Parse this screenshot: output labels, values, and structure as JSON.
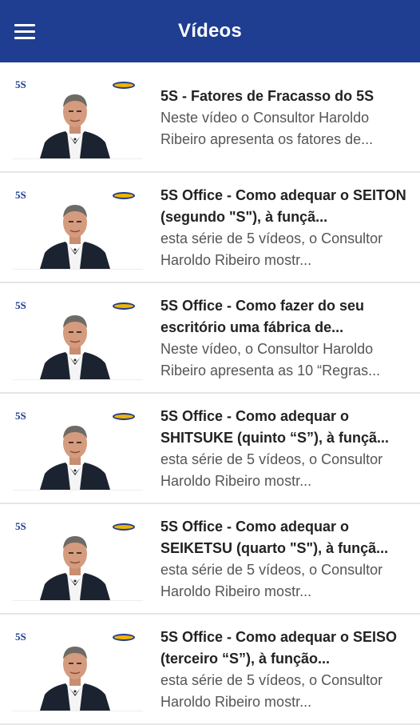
{
  "appbar": {
    "title": "Vídeos",
    "menu_icon": "hamburger-menu-icon"
  },
  "thumbnail": {
    "logo_text": "5S",
    "brand_color": "#f0b400",
    "accent": "#1f3d91"
  },
  "videos": [
    {
      "title": "5S - Fatores de Fracasso do 5S",
      "description": "Neste vídeo o Consultor Haroldo Ribeiro apresenta os fatores de..."
    },
    {
      "title": "5S Office - Como adequar o SEITON (segundo \"S\"), à funçã...",
      "description": "esta série de 5 vídeos, o Consultor Haroldo Ribeiro mostr..."
    },
    {
      "title": "5S Office - Como fazer do seu escritório uma fábrica de...",
      "description": "Neste vídeo, o Consultor Haroldo Ribeiro apresenta as 10 “Regras..."
    },
    {
      "title": "5S Office - Como adequar o SHITSUKE (quinto “S”), à funçã...",
      "description": "esta série de 5 vídeos, o Consultor Haroldo Ribeiro mostr..."
    },
    {
      "title": "5S Office - Como adequar o SEIKETSU (quarto \"S\"), à funçã...",
      "description": "esta série de 5 vídeos, o Consultor Haroldo Ribeiro mostr..."
    },
    {
      "title": "5S Office - Como adequar o SEISO (terceiro “S”), à função...",
      "description": "esta série de 5 vídeos, o Consultor Haroldo Ribeiro mostr..."
    }
  ]
}
